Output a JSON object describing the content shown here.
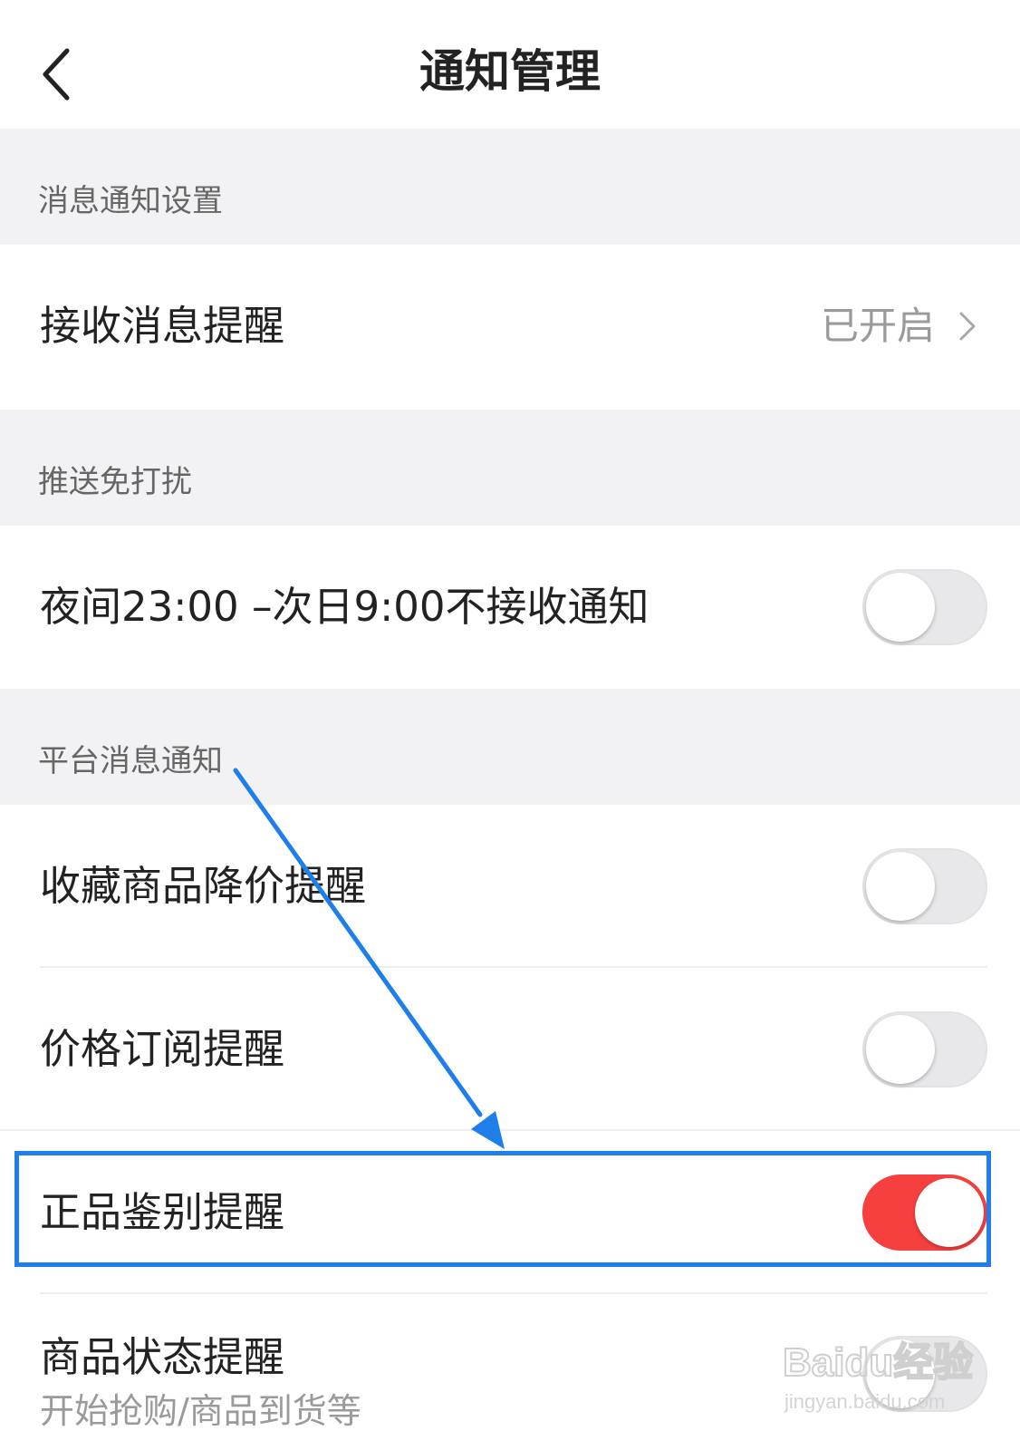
{
  "header": {
    "title": "通知管理"
  },
  "sections": {
    "message": "消息通知设置",
    "dnd": "推送免打扰",
    "platform": "平台消息通知"
  },
  "rows": {
    "receive": {
      "label": "接收消息提醒",
      "status": "已开启"
    },
    "night": {
      "label": "夜间23:00 –次日9:00不接收通知",
      "enabled": false
    },
    "price_drop": {
      "label": "收藏商品降价提醒",
      "enabled": false
    },
    "price_sub": {
      "label": "价格订阅提醒",
      "enabled": false
    },
    "authentic": {
      "label": "正品鉴别提醒",
      "enabled": true
    },
    "status": {
      "label": "商品状态提醒",
      "sublabel": "开始抢购/商品到货等",
      "enabled": false
    }
  },
  "watermark": {
    "brand": "Baidu经验",
    "url": "jingyan.baidu.com"
  },
  "colors": {
    "toggle_on": "#f6403f",
    "annotation": "#1e7fea",
    "section_bg": "#f2f2f4"
  }
}
